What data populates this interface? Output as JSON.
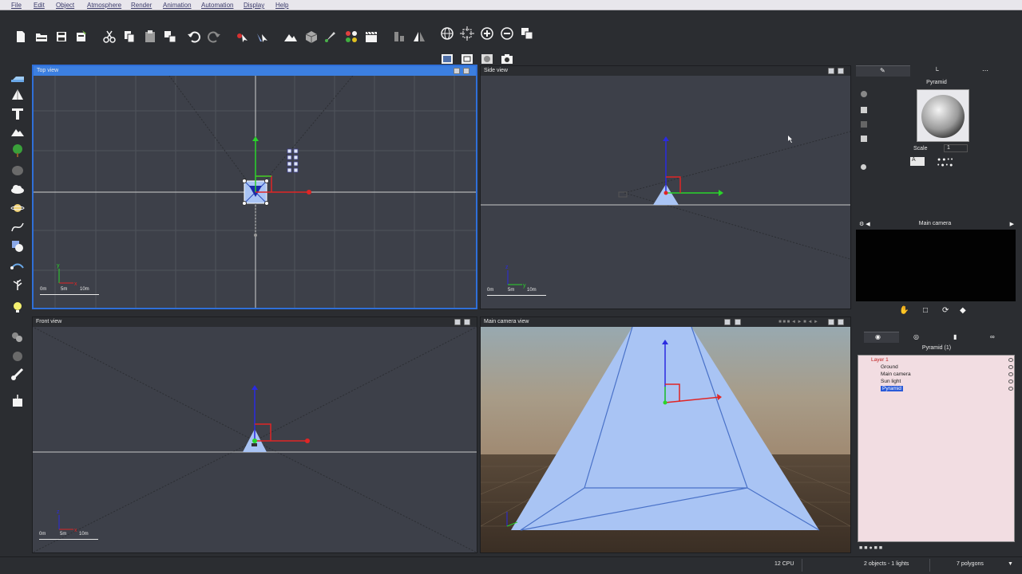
{
  "menu": {
    "items": [
      "File",
      "Edit",
      "Object",
      "Atmosphere",
      "Render",
      "Animation",
      "Automation",
      "Display",
      "Help"
    ]
  },
  "toolbar": {
    "icons": [
      "new-file-icon",
      "open-folder-icon",
      "save-icon",
      "reload-icon",
      "cut-icon",
      "copy-icon",
      "paste-icon",
      "duplicate-icon",
      "undo-icon",
      "redo-icon",
      "move-icon",
      "rotate-icon",
      "terrain-icon",
      "cube-icon",
      "brush-icon",
      "palette-icon",
      "clapper-icon",
      "align-icon",
      "mirror-icon",
      "globe-icon",
      "frame-icon",
      "zoom-in-icon",
      "zoom-out-icon",
      "copy-window-icon",
      "render-window-icon",
      "render-area-icon",
      "render-preview-icon",
      "camera-icon"
    ]
  },
  "viewports": {
    "top": {
      "title": "Top view",
      "scale": [
        "0m",
        "5m",
        "10m"
      ]
    },
    "side": {
      "title": "Side view",
      "scale": [
        "0m",
        "5m",
        "10m"
      ]
    },
    "front": {
      "title": "Front view",
      "scale": [
        "0m",
        "5m",
        "10m"
      ]
    },
    "camera": {
      "title": "Main camera view"
    }
  },
  "right_panel": {
    "material_title": "Pyramid",
    "scale_label": "Scale",
    "scale_value": "1",
    "camera_title": "Main camera",
    "objects_title": "Pyramid (1)",
    "tree": [
      {
        "label": "Layer 1",
        "indent": 0
      },
      {
        "label": "Ground",
        "indent": 1
      },
      {
        "label": "Main camera",
        "indent": 1
      },
      {
        "label": "Sun light",
        "indent": 1
      },
      {
        "label": "Pyramid",
        "indent": 1,
        "selected": true
      }
    ]
  },
  "status": {
    "cpu": "12 CPU",
    "objects": "2 objects - 1 lights",
    "polygons": "7 polygons"
  },
  "colors": {
    "active_viewport": "#2f6fd8",
    "viewport_bg": "#3d4049",
    "pyramid": "#a9c4f4",
    "axis_x": "#e02525",
    "axis_y": "#2ad52a",
    "axis_z": "#2a2ae0"
  }
}
